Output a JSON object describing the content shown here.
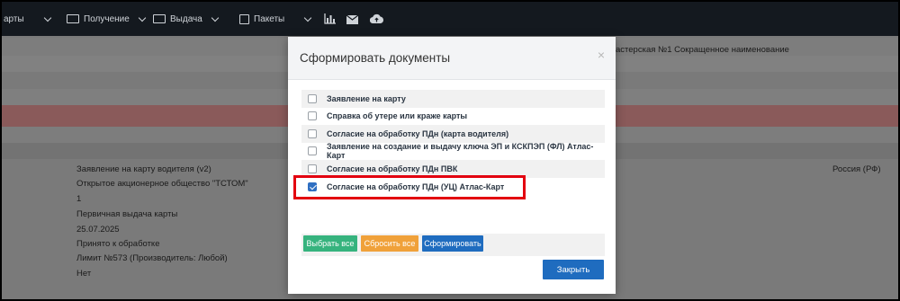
{
  "topnav": {
    "partial_label": "арты",
    "items": [
      {
        "label": "Получение",
        "icon": "id-card-icon"
      },
      {
        "label": "Выдача",
        "icon": "id-card-icon"
      },
      {
        "label": "Пакеты",
        "icon": "package-icon"
      }
    ],
    "tool_icons": [
      "bar-chart-icon",
      "envelope-icon",
      "cloud-upload-icon"
    ]
  },
  "background": {
    "header_right": "астерская №1 Сокращенное наименование",
    "country": "Россия (РФ)",
    "fields": [
      "Заявление на карту водителя (v2)",
      "Открытое акционерное общество \"ТСТОМ\"",
      "1",
      "Первичная выдача карты",
      "25.07.2025",
      "Принято к обработке",
      "Лимит №573 (Производитель: Любой)",
      "Нет"
    ]
  },
  "modal": {
    "title": "Сформировать документы",
    "close_symbol": "×",
    "documents": [
      {
        "label": "Заявление на карту",
        "checked": false
      },
      {
        "label": "Справка об утере или краже карты",
        "checked": false
      },
      {
        "label": "Согласие на обработку ПДн (карта водителя)",
        "checked": false
      },
      {
        "label": "Заявление на создание и выдачу ключа ЭП и КСКПЭП (ФЛ) Атлас-Карт",
        "checked": false
      },
      {
        "label": "Согласие на обработку ПДн ПВК",
        "checked": false
      },
      {
        "label": "Согласие на обработку ПДн (УЦ) Атлас-Карт",
        "checked": true
      }
    ],
    "select_all_label": "Выбрать все",
    "reset_all_label": "Сбросить все",
    "generate_label": "Сформировать",
    "close_label": "Закрыть"
  },
  "colors": {
    "nav_bg": "#14191f",
    "select_all": "#36b37e",
    "reset_all": "#f0a13a",
    "generate": "#1f6cbf",
    "highlight_border": "#e3000f"
  }
}
